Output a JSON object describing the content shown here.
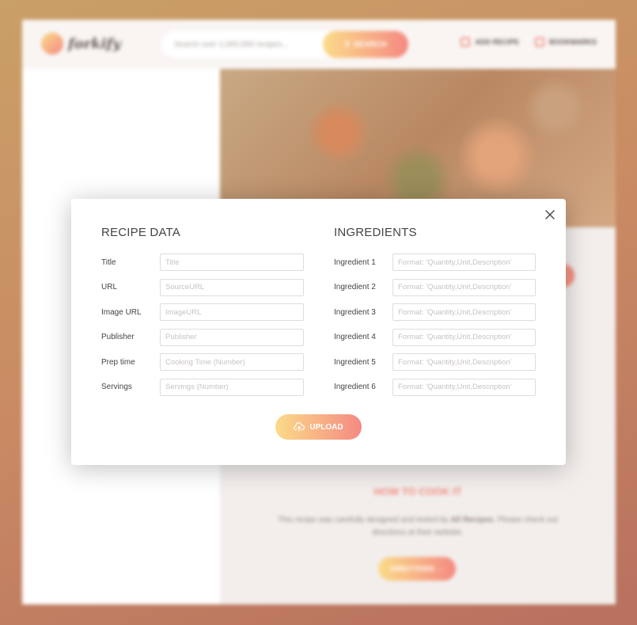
{
  "app": {
    "logo_text": "forkify",
    "search_placeholder": "Search over 1,000,000 recipes...",
    "search_button": "SEARCH",
    "nav": [
      {
        "label": "ADD RECIPE",
        "icon": "edit-icon"
      },
      {
        "label": "BOOKMARKS",
        "icon": "bookmark-icon"
      }
    ],
    "how_to_cook_title": "HOW TO COOK IT",
    "how_to_cook_text_pre": "This recipe was carefully designed and tested by ",
    "how_to_cook_publisher": "All Recipes",
    "how_to_cook_text_post": ". Please check out directions at their website.",
    "directions_button": "DIRECTIONS"
  },
  "modal": {
    "recipe_heading": "RECIPE DATA",
    "ingredients_heading": "INGREDIENTS",
    "recipe_fields": [
      {
        "label": "Title",
        "placeholder": "Title",
        "value": ""
      },
      {
        "label": "URL",
        "placeholder": "SourceURL",
        "value": ""
      },
      {
        "label": "Image URL",
        "placeholder": "ImageURL",
        "value": ""
      },
      {
        "label": "Publisher",
        "placeholder": "Publisher",
        "value": ""
      },
      {
        "label": "Prep time",
        "placeholder": "Cooking Time (Number)",
        "value": ""
      },
      {
        "label": "Servings",
        "placeholder": "Servings (Number)",
        "value": ""
      }
    ],
    "ingredient_fields": [
      {
        "label": "Ingredient 1",
        "placeholder": "Format: 'Quantity,Unit,Description'",
        "value": ""
      },
      {
        "label": "Ingredient 2",
        "placeholder": "Format: 'Quantity,Unit,Description'",
        "value": ""
      },
      {
        "label": "Ingredient 3",
        "placeholder": "Format: 'Quantity,Unit,Description'",
        "value": ""
      },
      {
        "label": "Ingredient 4",
        "placeholder": "Format: 'Quantity,Unit,Description'",
        "value": ""
      },
      {
        "label": "Ingredient 5",
        "placeholder": "Format: 'Quantity,Unit,Description'",
        "value": ""
      },
      {
        "label": "Ingredient 6",
        "placeholder": "Format: 'Quantity,Unit,Description'",
        "value": ""
      }
    ],
    "upload_button": "UPLOAD",
    "close_icon": "close-icon",
    "upload_icon": "cloud-upload-icon"
  },
  "colors": {
    "accent_start": "#fbdb89",
    "accent_end": "#f48982",
    "text": "#444444"
  }
}
